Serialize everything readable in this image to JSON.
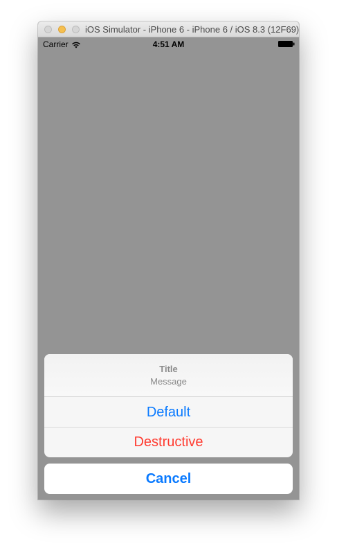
{
  "window": {
    "title": "iOS Simulator - iPhone 6 - iPhone 6 / iOS 8.3 (12F69)"
  },
  "statusbar": {
    "carrier": "Carrier",
    "time": "4:51 AM",
    "icons": [
      "wifi-icon",
      "battery-icon"
    ]
  },
  "action_sheet": {
    "title": "Title",
    "message": "Message",
    "actions": [
      {
        "label": "Default",
        "style": "default",
        "color": "#0a7aff"
      },
      {
        "label": "Destructive",
        "style": "destructive",
        "color": "#ff3b30"
      }
    ],
    "cancel_label": "Cancel"
  },
  "colors": {
    "background_dim": "#949494",
    "ios_blue": "#0a7aff",
    "ios_red": "#ff3b30",
    "minimize_yellow": "#f5bf4f"
  }
}
